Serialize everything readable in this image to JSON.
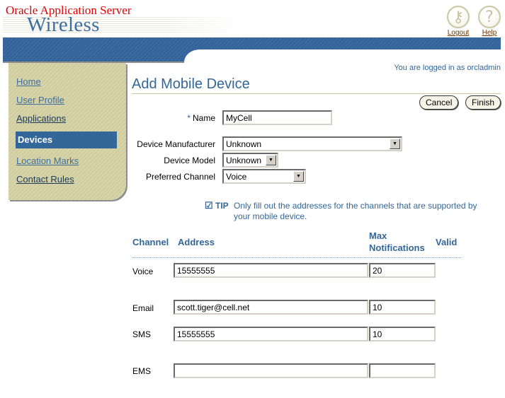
{
  "branding": {
    "company": "Oracle Application Server",
    "product": "Wireless"
  },
  "global_buttons": [
    {
      "label": "Logout",
      "icon": "key-icon"
    },
    {
      "label": "Help",
      "icon": "question-icon"
    }
  ],
  "login_status": "You are logged in as orcladmin",
  "sidebar": {
    "items": [
      {
        "label": "Home",
        "state": "visited"
      },
      {
        "label": "User Profile",
        "state": "visited"
      },
      {
        "label": "Applications",
        "state": "link"
      },
      {
        "label": "Devices",
        "state": "active"
      },
      {
        "label": "Location Marks",
        "state": "visited"
      },
      {
        "label": "Contact Rules",
        "state": "link"
      }
    ]
  },
  "page": {
    "title": "Add Mobile Device",
    "buttons": {
      "cancel": "Cancel",
      "finish": "Finish"
    }
  },
  "form": {
    "name": {
      "label": "Name",
      "required_marker": "*",
      "value": "MyCell"
    },
    "device_manufacturer": {
      "label": "Device Manufacturer",
      "value": "Unknown"
    },
    "device_model": {
      "label": "Device Model",
      "value": "Unknown"
    },
    "preferred_channel": {
      "label": "Preferred Channel",
      "value": "Voice"
    }
  },
  "tip": {
    "icon": "checkmark-icon",
    "label": "TIP",
    "line1": "Only fill out the addresses for the channels that are supported by",
    "line2": "your mobile device."
  },
  "channels_table": {
    "headers": {
      "channel": "Channel",
      "address": "Address",
      "max_line1": "Max",
      "max_line2": "Notifications",
      "valid": "Valid"
    },
    "rows": [
      {
        "channel": "Voice",
        "address": "15555555",
        "max_notifications": "20"
      },
      {
        "channel": "Email",
        "address": "scott.tiger@cell.net",
        "max_notifications": "10"
      },
      {
        "channel": "SMS",
        "address": "15555555",
        "max_notifications": "10"
      },
      {
        "channel": "EMS",
        "address": "",
        "max_notifications": ""
      }
    ]
  }
}
